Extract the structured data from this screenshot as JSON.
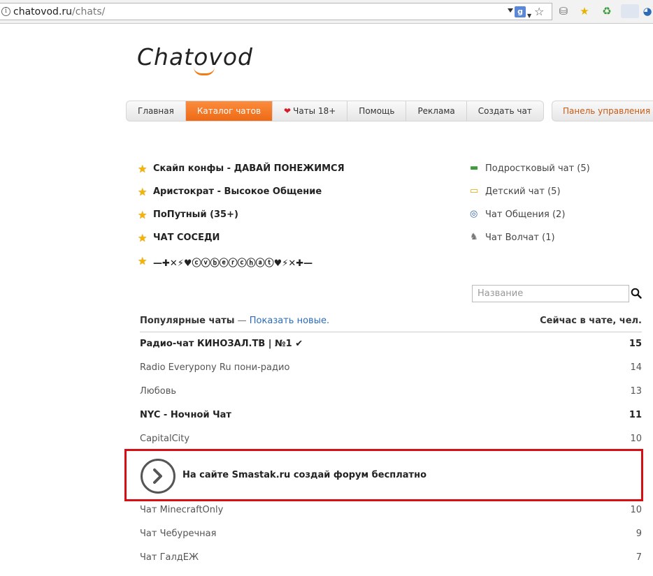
{
  "browser": {
    "url_host": "chatovod.ru",
    "url_path": "/chats/"
  },
  "site": {
    "logo_text": "Chatovod"
  },
  "nav": {
    "items": [
      {
        "label": "Главная"
      },
      {
        "label": "Каталог чатов"
      },
      {
        "label": "Чаты 18+"
      },
      {
        "label": "Помощь"
      },
      {
        "label": "Реклама"
      },
      {
        "label": "Создать чат"
      }
    ],
    "panel_label": "Панель управления"
  },
  "featured": [
    {
      "label": "Скайп конфы - ДАВАЙ ПОНЕЖИМСЯ"
    },
    {
      "label": "Аристократ - Высокое Общение"
    },
    {
      "label": "ПоПутный (35+)"
    },
    {
      "label": "ЧАТ СОСЕДИ"
    },
    {
      "label": "—✚✕⚡♥ⓒⓥⓑⓔⓡⓒⓗⓐⓣ♥⚡✕✚—"
    }
  ],
  "categories": [
    {
      "label": "Подростковый чат (5)",
      "icon": "speech-bubbles-icon"
    },
    {
      "label": "Детский чат (5)",
      "icon": "speech-bubble-icon"
    },
    {
      "label": "Чат Общения (2)",
      "icon": "chat-circle-icon"
    },
    {
      "label": "Чат Волчат (1)",
      "icon": "wolf-icon"
    }
  ],
  "search": {
    "placeholder": "Название"
  },
  "table": {
    "heading": "Популярные чаты",
    "dash": " — ",
    "show_new": "Показать новые.",
    "count_header": "Сейчас в чате, чел."
  },
  "rows_top": [
    {
      "name": "Радио-чат КИНОЗАЛ.ТВ | №1 ✔",
      "count": "15",
      "bold": true
    },
    {
      "name": "Radio Everypony Ru пони-радио",
      "count": "14",
      "bold": false
    },
    {
      "name": "Любовь",
      "count": "13",
      "bold": false
    },
    {
      "name": "NYC - Ночной Чат",
      "count": "11",
      "bold": true
    },
    {
      "name": "CapitalCity",
      "count": "10",
      "bold": false
    }
  ],
  "promo": {
    "text": "На сайте Smastak.ru создай форум бесплатно"
  },
  "rows_bottom": [
    {
      "name": "Чат MinecraftOnly",
      "count": "10",
      "bold": false
    },
    {
      "name": "Чат Чебуречная",
      "count": "9",
      "bold": false
    },
    {
      "name": "Чат ГалдЕЖ",
      "count": "7",
      "bold": false
    }
  ],
  "colors": {
    "accent": "#ee6a15",
    "promo_border": "#d50f14",
    "link": "#2a6cb8"
  }
}
